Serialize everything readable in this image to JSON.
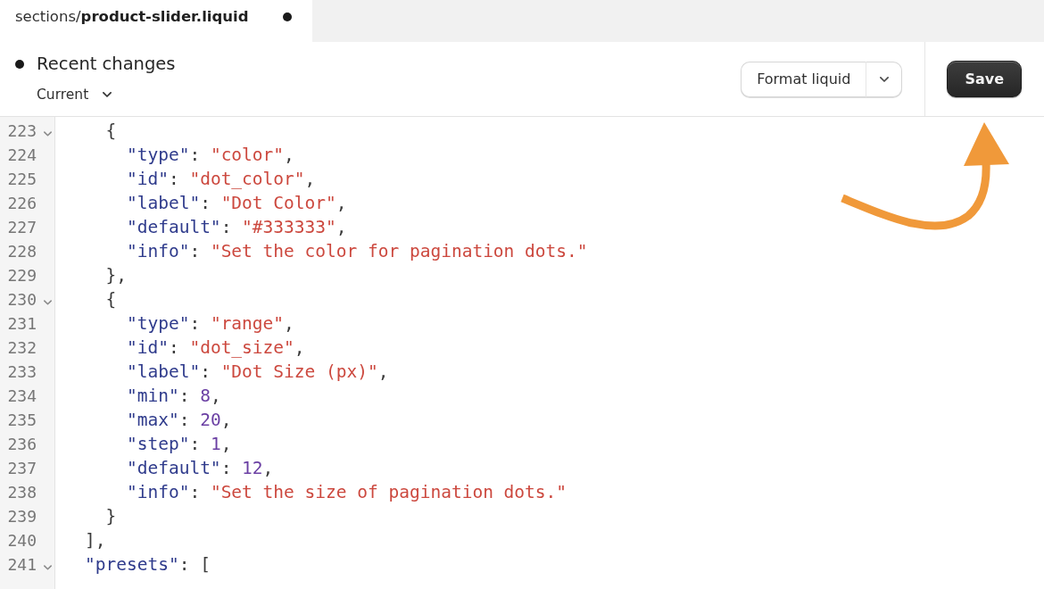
{
  "tabs": [
    {
      "label": "sections/**product-slider.liquid**",
      "selected": true,
      "modified": true
    }
  ],
  "toolbar": {
    "history": {
      "title": "Recent changes",
      "unsaved": true,
      "version": "Current"
    },
    "format_button": {
      "label": "Format liquid"
    },
    "save_button": {
      "label": "Save"
    }
  },
  "editor": {
    "lines": [
      {
        "children": [
          {
            "number": "223",
            "foldable": true,
            "expanded": true,
            "tokens": [
              {
                "kind": "punct",
                "text": "{"
              }
            ],
            "children": [
              {
                "number": "224",
                "foldable": false,
                "tokens": [
                  {
                    "kind": "key",
                    "text": "\"type\""
                  },
                  {
                    "kind": "punct",
                    "text": ": "
                  },
                  {
                    "kind": "string",
                    "text": "\"color\""
                  },
                  {
                    "kind": "punct",
                    "text": ","
                  }
                ]
              },
              {
                "number": "225",
                "foldable": false,
                "tokens": [
                  {
                    "kind": "key",
                    "text": "\"id\""
                  },
                  {
                    "kind": "punct",
                    "text": ": "
                  },
                  {
                    "kind": "string",
                    "text": "\"dot_color\""
                  },
                  {
                    "kind": "punct",
                    "text": ","
                  }
                ]
              },
              {
                "number": "226",
                "foldable": false,
                "tokens": [
                  {
                    "kind": "key",
                    "text": "\"label\""
                  },
                  {
                    "kind": "punct",
                    "text": ": "
                  },
                  {
                    "kind": "string",
                    "text": "\"Dot Color\""
                  },
                  {
                    "kind": "punct",
                    "text": ","
                  }
                ]
              },
              {
                "number": "227",
                "foldable": false,
                "tokens": [
                  {
                    "kind": "key",
                    "text": "\"default\""
                  },
                  {
                    "kind": "punct",
                    "text": ": "
                  },
                  {
                    "kind": "string",
                    "text": "\"#333333\""
                  },
                  {
                    "kind": "punct",
                    "text": ","
                  }
                ]
              },
              {
                "number": "228",
                "foldable": false,
                "tokens": [
                  {
                    "kind": "key",
                    "text": "\"info\""
                  },
                  {
                    "kind": "punct",
                    "text": ": "
                  },
                  {
                    "kind": "string",
                    "text": "\"Set the color for pagination dots.\""
                  }
                ]
              }
            ]
          },
          {
            "number": "229",
            "foldable": false,
            "tokens": [
              {
                "kind": "punct",
                "text": "},"
              }
            ]
          },
          {
            "number": "230",
            "foldable": true,
            "expanded": true,
            "tokens": [
              {
                "kind": "punct",
                "text": "{"
              }
            ],
            "children": [
              {
                "number": "231",
                "foldable": false,
                "tokens": [
                  {
                    "kind": "key",
                    "text": "\"type\""
                  },
                  {
                    "kind": "punct",
                    "text": ": "
                  },
                  {
                    "kind": "string",
                    "text": "\"range\""
                  },
                  {
                    "kind": "punct",
                    "text": ","
                  }
                ]
              },
              {
                "number": "232",
                "foldable": false,
                "tokens": [
                  {
                    "kind": "key",
                    "text": "\"id\""
                  },
                  {
                    "kind": "punct",
                    "text": ": "
                  },
                  {
                    "kind": "string",
                    "text": "\"dot_size\""
                  },
                  {
                    "kind": "punct",
                    "text": ","
                  }
                ]
              },
              {
                "number": "233",
                "foldable": false,
                "tokens": [
                  {
                    "kind": "key",
                    "text": "\"label\""
                  },
                  {
                    "kind": "punct",
                    "text": ": "
                  },
                  {
                    "kind": "string",
                    "text": "\"Dot Size (px)\""
                  },
                  {
                    "kind": "punct",
                    "text": ","
                  }
                ]
              },
              {
                "number": "234",
                "foldable": false,
                "tokens": [
                  {
                    "kind": "key",
                    "text": "\"min\""
                  },
                  {
                    "kind": "punct",
                    "text": ": "
                  },
                  {
                    "kind": "number",
                    "text": "8"
                  },
                  {
                    "kind": "punct",
                    "text": ","
                  }
                ]
              },
              {
                "number": "235",
                "foldable": false,
                "tokens": [
                  {
                    "kind": "key",
                    "text": "\"max\""
                  },
                  {
                    "kind": "punct",
                    "text": ": "
                  },
                  {
                    "kind": "number",
                    "text": "20"
                  },
                  {
                    "kind": "punct",
                    "text": ","
                  }
                ]
              },
              {
                "number": "236",
                "foldable": false,
                "tokens": [
                  {
                    "kind": "key",
                    "text": "\"step\""
                  },
                  {
                    "kind": "punct",
                    "text": ": "
                  },
                  {
                    "kind": "number",
                    "text": "1"
                  },
                  {
                    "kind": "punct",
                    "text": ","
                  }
                ]
              },
              {
                "number": "237",
                "foldable": false,
                "tokens": [
                  {
                    "kind": "key",
                    "text": "\"default\""
                  },
                  {
                    "kind": "punct",
                    "text": ": "
                  },
                  {
                    "kind": "number",
                    "text": "12"
                  },
                  {
                    "kind": "punct",
                    "text": ","
                  }
                ]
              },
              {
                "number": "238",
                "foldable": false,
                "tokens": [
                  {
                    "kind": "key",
                    "text": "\"info\""
                  },
                  {
                    "kind": "punct",
                    "text": ": "
                  },
                  {
                    "kind": "string",
                    "text": "\"Set the size of pagination dots.\""
                  }
                ]
              }
            ]
          },
          {
            "number": "239",
            "foldable": false,
            "tokens": [
              {
                "kind": "punct",
                "text": "}"
              }
            ]
          }
        ]
      },
      {
        "number": "240",
        "foldable": false,
        "tokens": [
          {
            "kind": "punct",
            "text": "],"
          }
        ]
      },
      {
        "number": "241",
        "foldable": true,
        "expanded": true,
        "tokens": [
          {
            "kind": "key",
            "text": "\"presets\""
          },
          {
            "kind": "punct",
            "text": ": ["
          }
        ]
      }
    ]
  }
}
